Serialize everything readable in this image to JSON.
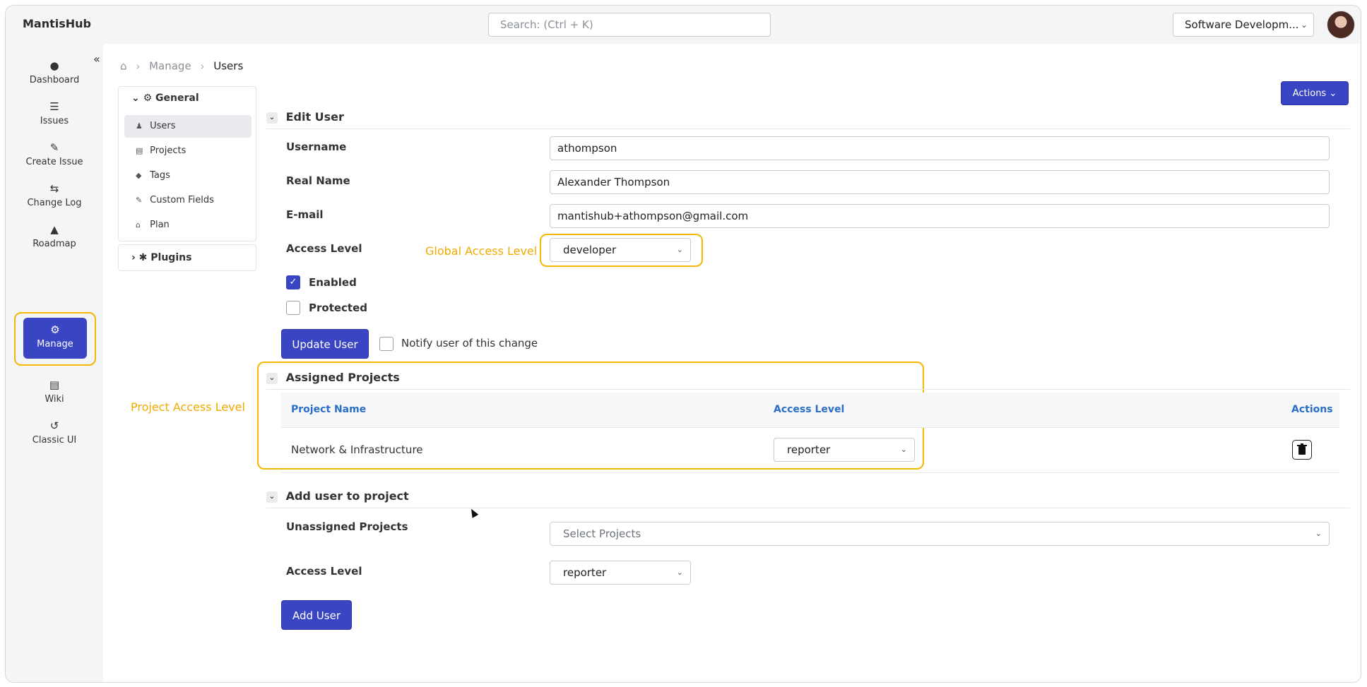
{
  "app": {
    "brand": "MantisHub"
  },
  "search": {
    "placeholder": "Search: (Ctrl + K)"
  },
  "project_switcher": {
    "value": "Software Developm..."
  },
  "sidebar": {
    "items": [
      {
        "label": "Dashboard",
        "icon": "dashboard-icon"
      },
      {
        "label": "Issues",
        "icon": "list-icon"
      },
      {
        "label": "Create Issue",
        "icon": "edit-icon"
      },
      {
        "label": "Change Log",
        "icon": "changelog-icon"
      },
      {
        "label": "Roadmap",
        "icon": "road-icon"
      },
      {
        "label": "Manage",
        "icon": "gears-icon",
        "active": true
      },
      {
        "label": "Wiki",
        "icon": "file-icon"
      },
      {
        "label": "Classic UI",
        "icon": "history-icon"
      }
    ]
  },
  "breadcrumb": {
    "manage": "Manage",
    "current": "Users"
  },
  "toolbar": {
    "actions_label": "Actions"
  },
  "left_menu": {
    "general": "General",
    "items": [
      "Users",
      "Projects",
      "Tags",
      "Custom Fields",
      "Plan"
    ],
    "plugins": "Plugins"
  },
  "edit_user": {
    "title": "Edit User",
    "username_label": "Username",
    "username": "athompson",
    "realname_label": "Real Name",
    "realname": "Alexander Thompson",
    "email_label": "E-mail",
    "email": "mantishub+athompson@gmail.com",
    "access_label": "Access Level",
    "access_value": "developer",
    "enabled_label": "Enabled",
    "protected_label": "Protected",
    "update_button": "Update User",
    "notify_label": "Notify user of this change"
  },
  "annotations": {
    "global_access": "Global Access Level",
    "project_access": "Project Access Level",
    "highlight_color": "#f5b800"
  },
  "assigned_projects": {
    "title": "Assigned Projects",
    "columns": [
      "Project Name",
      "Access Level",
      "Actions"
    ],
    "rows": [
      {
        "project": "Network & Infrastructure",
        "access": "reporter"
      }
    ]
  },
  "add_user": {
    "title": "Add user to project",
    "unassigned_label": "Unassigned Projects",
    "unassigned_placeholder": "Select Projects",
    "access_label": "Access Level",
    "access_value": "reporter",
    "add_button": "Add User"
  },
  "colors": {
    "primary": "#3a45c4",
    "link": "#2a6fc5"
  }
}
